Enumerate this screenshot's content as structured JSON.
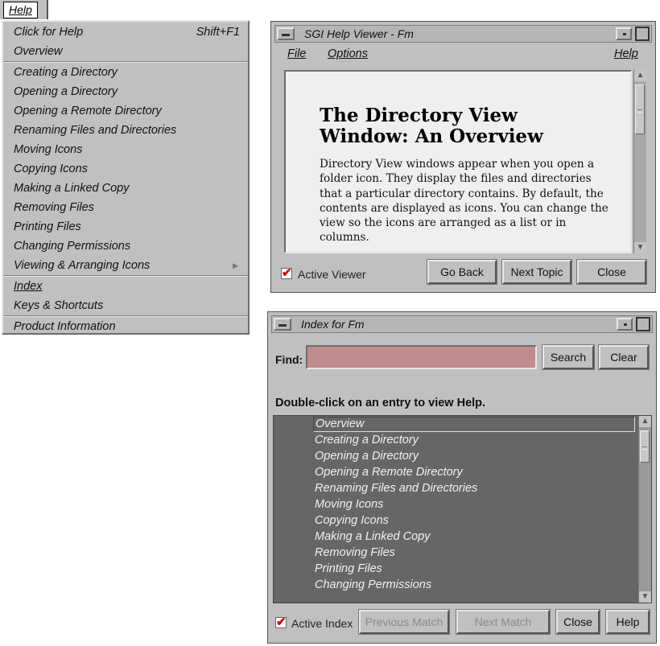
{
  "help_menu": {
    "title": "Help",
    "items": [
      {
        "label": "Click for Help",
        "accelerator": "Shift+F1"
      },
      {
        "label": "Overview"
      },
      {
        "label": "Creating a Directory"
      },
      {
        "label": "Opening a Directory"
      },
      {
        "label": "Opening a Remote Directory"
      },
      {
        "label": "Renaming Files and Directories"
      },
      {
        "label": "Moving Icons"
      },
      {
        "label": "Copying Icons"
      },
      {
        "label": "Making a Linked Copy"
      },
      {
        "label": "Removing Files"
      },
      {
        "label": "Printing Files"
      },
      {
        "label": "Changing Permissions"
      },
      {
        "label": "Viewing & Arranging Icons",
        "submenu_arrow": "▶"
      },
      {
        "label": "Index"
      },
      {
        "label": "Keys & Shortcuts"
      },
      {
        "label": "Product Information"
      }
    ]
  },
  "viewer": {
    "title": "SGI Help Viewer - Fm",
    "menus": {
      "file": "File",
      "options": "Options",
      "help": "Help"
    },
    "content_title": "The Directory View Window: An Overview",
    "content_body": "Directory View windows appear when you open a folder icon. They display the files and directories that a particular directory contains. By default, the contents are displayed as icons. You can change the view so the icons are arranged as a list or in columns.",
    "active_viewer_label": "Active Viewer",
    "active_viewer_checked": true,
    "buttons": {
      "go_back": "Go Back",
      "next_topic": "Next Topic",
      "close": "Close"
    }
  },
  "index_window": {
    "title": "Index for Fm",
    "find_label": "Find:",
    "find_value": "",
    "search_button": "Search",
    "clear_button": "Clear",
    "hint": "Double-click on an entry to view Help.",
    "entries": [
      "Overview",
      "Creating a Directory",
      "Opening a Directory",
      "Opening a Remote Directory",
      "Renaming Files and Directories",
      "Moving Icons",
      "Copying Icons",
      "Making a Linked Copy",
      "Removing Files",
      "Printing Files",
      "Changing Permissions"
    ],
    "selected_entry": "Overview",
    "active_index_label": "Active Index",
    "active_index_checked": true,
    "buttons": {
      "previous_match": "Previous Match",
      "next_match": "Next Match",
      "close": "Close",
      "help": "Help"
    }
  },
  "colors": {
    "window_bg": "#c0c0c0",
    "find_field": "#c08c8c",
    "list_bg": "#666666",
    "check_mark": "#d10000"
  },
  "icons": [
    "window-menu-icon",
    "minimize-icon",
    "maximize-icon",
    "scroll-up-icon",
    "scroll-down-icon",
    "checkbox-icon"
  ]
}
